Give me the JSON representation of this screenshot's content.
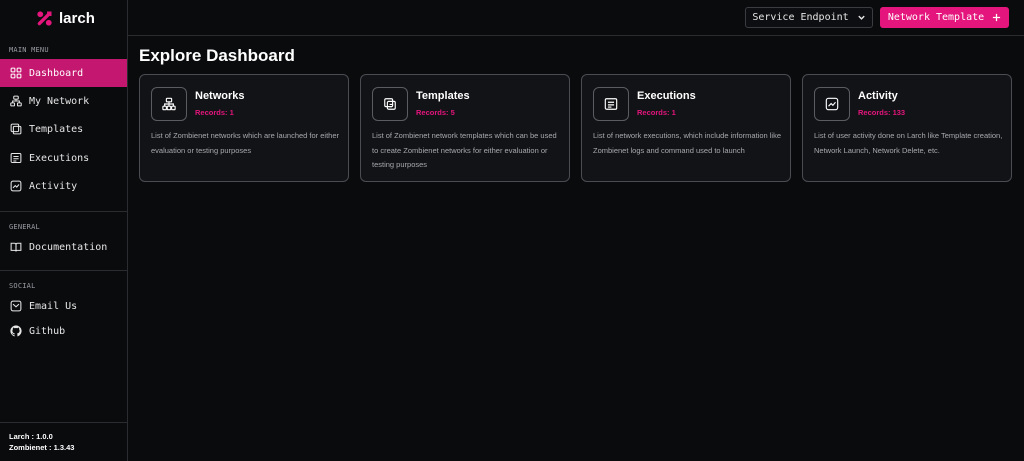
{
  "brand": {
    "name": "larch",
    "accent": "#e4157c"
  },
  "sidebar": {
    "sections": {
      "main": "MAIN MENU",
      "general": "GENERAL",
      "social": "SOCIAL"
    },
    "main_items": [
      {
        "label": "Dashboard",
        "icon": "dashboard-icon",
        "active": true
      },
      {
        "label": "My Network",
        "icon": "network-icon"
      },
      {
        "label": "Templates",
        "icon": "templates-icon"
      },
      {
        "label": "Executions",
        "icon": "executions-icon"
      },
      {
        "label": "Activity",
        "icon": "activity-icon"
      }
    ],
    "general_items": [
      {
        "label": "Documentation",
        "icon": "book-icon"
      }
    ],
    "social_items": [
      {
        "label": "Email Us",
        "icon": "mail-icon"
      },
      {
        "label": "Github",
        "icon": "github-icon"
      }
    ],
    "versions": {
      "larch": "Larch : 1.0.0",
      "zombienet": "Zombienet : 1.3.43"
    }
  },
  "header": {
    "endpoint_label": "Service Endpoint",
    "endpoint_icon": "chevron-down-icon",
    "template_label": "Network Template",
    "template_icon": "plus-icon"
  },
  "main": {
    "title": "Explore Dashboard",
    "cards": [
      {
        "title": "Networks",
        "records": "Records: 1",
        "icon": "network-tree-icon",
        "description": "List of Zombienet networks which are launched for either evaluation or testing purposes"
      },
      {
        "title": "Templates",
        "records": "Records: 5",
        "icon": "template-copy-icon",
        "description": "List of Zombienet network templates which can be used to create Zombienet networks for either evaluation or testing purposes"
      },
      {
        "title": "Executions",
        "records": "Records: 1",
        "icon": "execution-list-icon",
        "description": "List of network executions, which include information like Zombienet logs and command used to launch"
      },
      {
        "title": "Activity",
        "records": "Records: 133",
        "icon": "activity-chart-icon",
        "description": "List of user activity done on Larch like Template creation, Network Launch, Network Delete, etc."
      }
    ]
  }
}
